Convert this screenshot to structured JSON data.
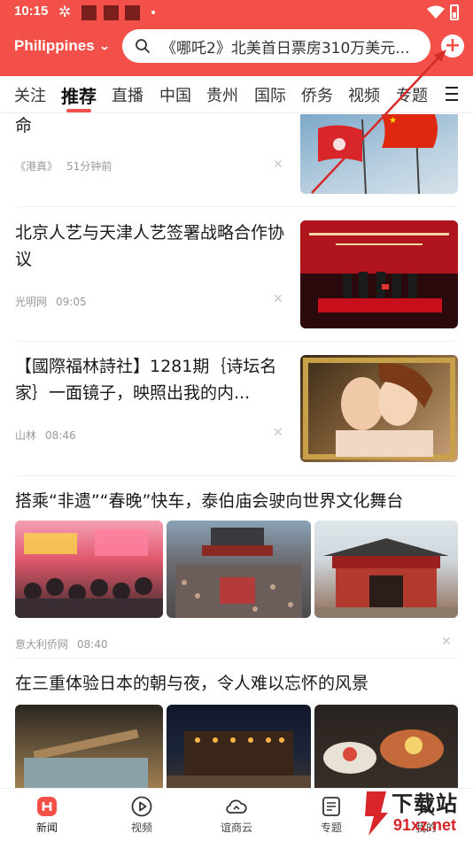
{
  "status_bar": {
    "time": "10:15"
  },
  "header": {
    "region": "Philippines",
    "search_text": "《哪吒2》北美首日票房310万美元..."
  },
  "tabs": [
    "关注",
    "推荐",
    "直播",
    "中国",
    "贵州",
    "国际",
    "侨务",
    "视频",
    "专题"
  ],
  "active_tab": "推荐",
  "articles": [
    {
      "title": "命",
      "source": "《港真》",
      "time": "51分钟前"
    },
    {
      "title": "北京人艺与天津人艺签署战略合作协议",
      "source": "光明网",
      "time": "09:05"
    },
    {
      "title": "【國際福林詩社】1281期｛诗坛名家｝一面镜子，映照出我的内...",
      "source": "山林",
      "time": "08:46"
    },
    {
      "title": "搭乘“非遗”“春晚”快车，泰伯庙会驶向世界文化舞台",
      "source": "意大利侨网",
      "time": "08:40"
    },
    {
      "title": "在三重体验日本的朝与夜，令人难以忘怀的风景"
    }
  ],
  "bottom_nav": [
    {
      "label": "新闻",
      "icon": "news-icon",
      "active": true
    },
    {
      "label": "视频",
      "icon": "play-icon",
      "active": false
    },
    {
      "label": "谊商云",
      "icon": "cloud-icon",
      "active": false
    },
    {
      "label": "专题",
      "icon": "topic-icon",
      "active": false
    },
    {
      "label": "我的",
      "icon": "profile-icon",
      "active": false
    }
  ],
  "watermark": {
    "top": "下载站",
    "bottom": "91xz.net"
  },
  "colors": {
    "brand": "#f25048",
    "annotation_arrow": "#d42a2a"
  }
}
